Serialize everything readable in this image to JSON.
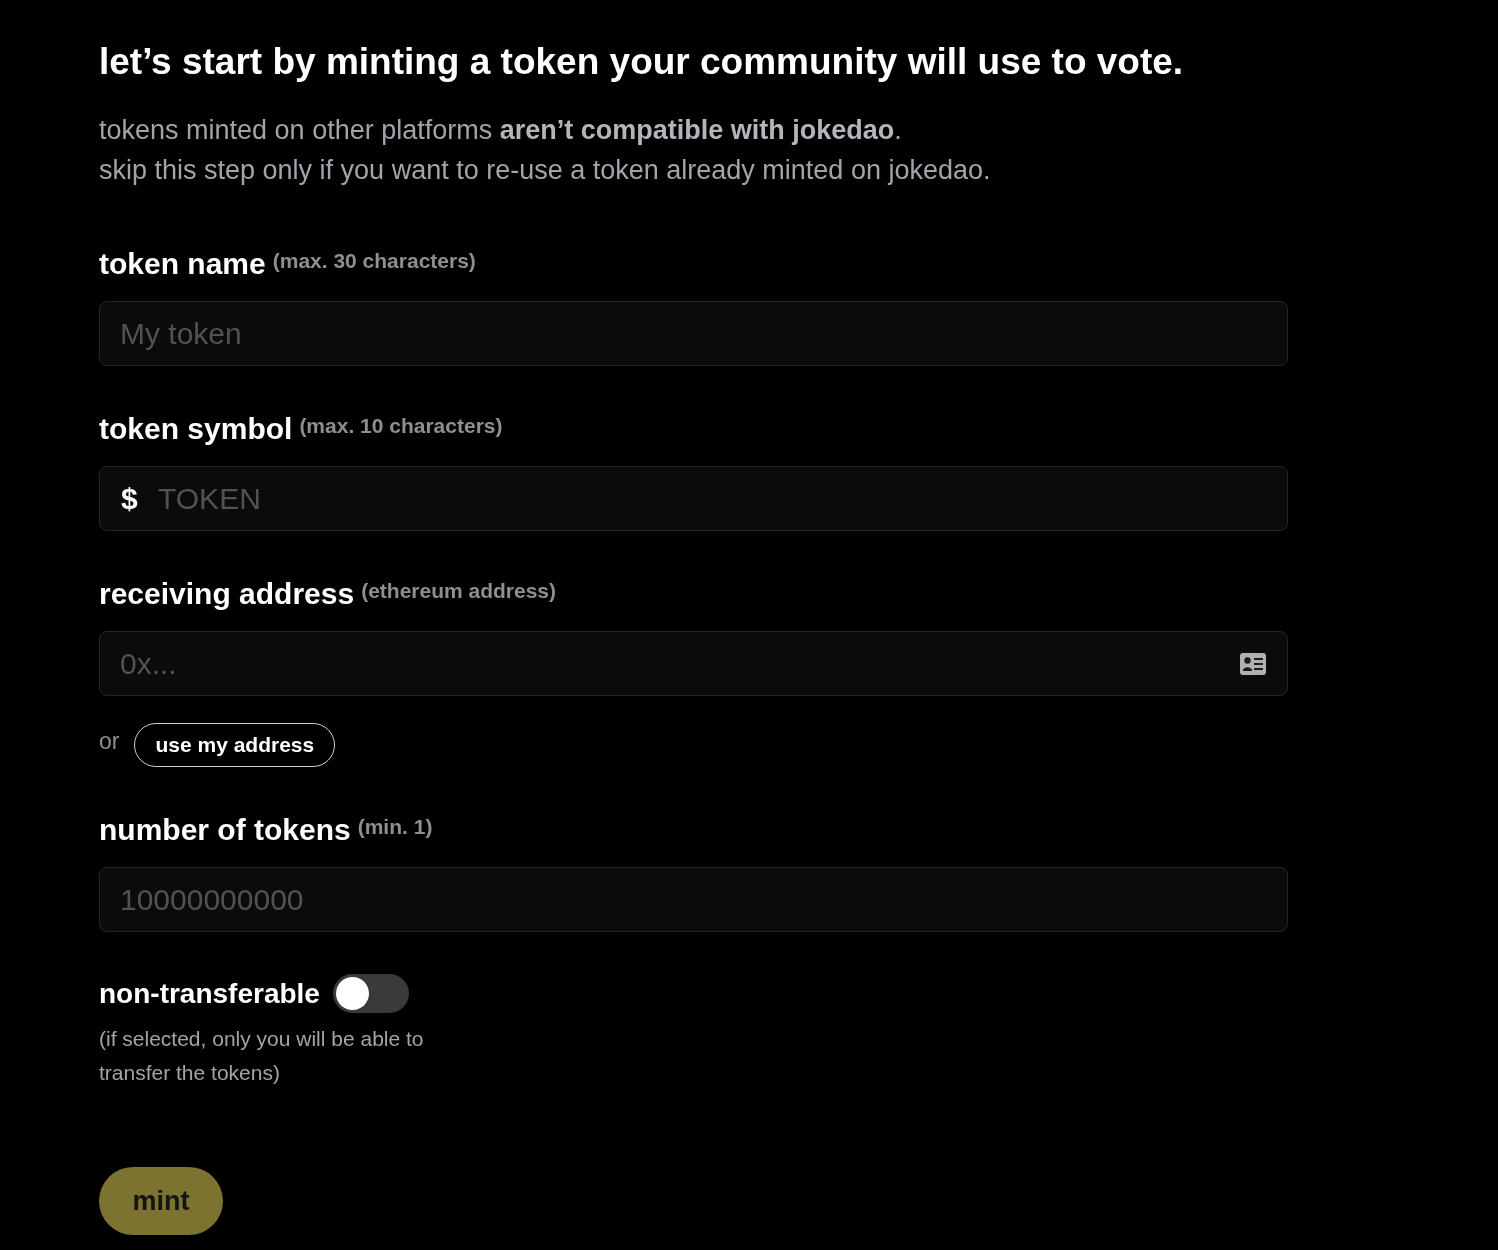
{
  "heading": "let’s start by minting a token your community will use to vote.",
  "intro": [
    "tokens minted on other platforms **aren’t compatible with jokedao**.",
    "skip this step only if you want to re-use a token already minted on jokedao."
  ],
  "fields": [
    {
      "kind": "text",
      "label": "token name",
      "hint": "(max. 30 characters)",
      "placeholder": "My token"
    },
    {
      "kind": "prefixed",
      "label": "token symbol",
      "hint": "(max. 10 characters)",
      "prefix": "$",
      "placeholder": "TOKEN"
    },
    {
      "kind": "address",
      "label": "receiving address",
      "hint": "(ethereum address)",
      "placeholder": "0x...",
      "alternative": {
        "text": "or",
        "button": "use my address"
      }
    },
    {
      "kind": "text",
      "label": "number of tokens",
      "hint": "(min. 1)",
      "placeholder": "10000000000"
    }
  ],
  "toggle": {
    "label": "non-transferable",
    "on": false,
    "help": "(if selected, only you will be able to transfer the tokens)"
  },
  "submit": {
    "label": "mint"
  }
}
